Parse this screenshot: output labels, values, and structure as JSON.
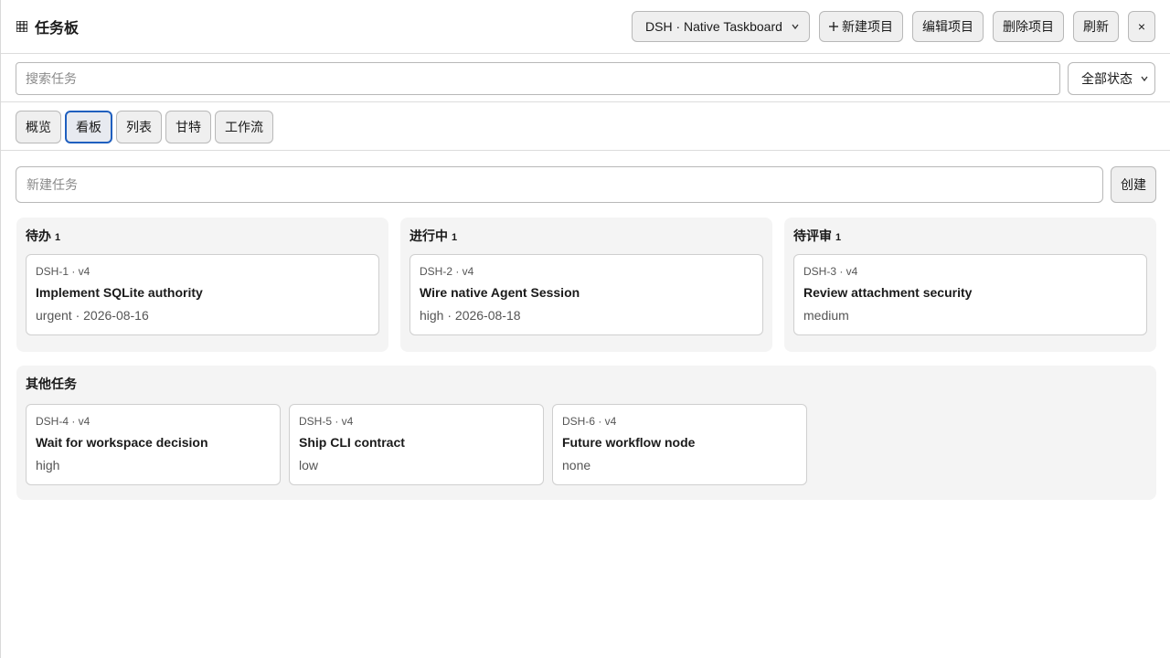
{
  "header": {
    "title": "任务板",
    "project_select": "DSH · Native Taskboard",
    "new_project": "新建项目",
    "edit_project": "编辑项目",
    "delete_project": "删除项目",
    "refresh": "刷新",
    "close": "×"
  },
  "search": {
    "placeholder": "搜索任务",
    "status_filter": "全部状态"
  },
  "tabs": [
    {
      "label": "概览"
    },
    {
      "label": "看板"
    },
    {
      "label": "列表"
    },
    {
      "label": "甘特"
    },
    {
      "label": "工作流"
    }
  ],
  "new_task": {
    "placeholder": "新建任务",
    "create": "创建"
  },
  "columns": [
    {
      "title": "待办",
      "count": "1",
      "cards": [
        {
          "id": "DSH-1 · v4",
          "title": "Implement SQLite authority",
          "meta": "urgent · 2026-08-16"
        }
      ]
    },
    {
      "title": "进行中",
      "count": "1",
      "cards": [
        {
          "id": "DSH-2 · v4",
          "title": "Wire native Agent Session",
          "meta": "high · 2026-08-18"
        }
      ]
    },
    {
      "title": "待评审",
      "count": "1",
      "cards": [
        {
          "id": "DSH-3 · v4",
          "title": "Review attachment security",
          "meta": "medium"
        }
      ]
    }
  ],
  "other": {
    "title": "其他任务",
    "cards": [
      {
        "id": "DSH-4 · v4",
        "title": "Wait for workspace decision",
        "meta": "high"
      },
      {
        "id": "DSH-5 · v4",
        "title": "Ship CLI contract",
        "meta": "low"
      },
      {
        "id": "DSH-6 · v4",
        "title": "Future workflow node",
        "meta": "none"
      }
    ]
  },
  "colors": {
    "accent": "#1f5fbf"
  }
}
